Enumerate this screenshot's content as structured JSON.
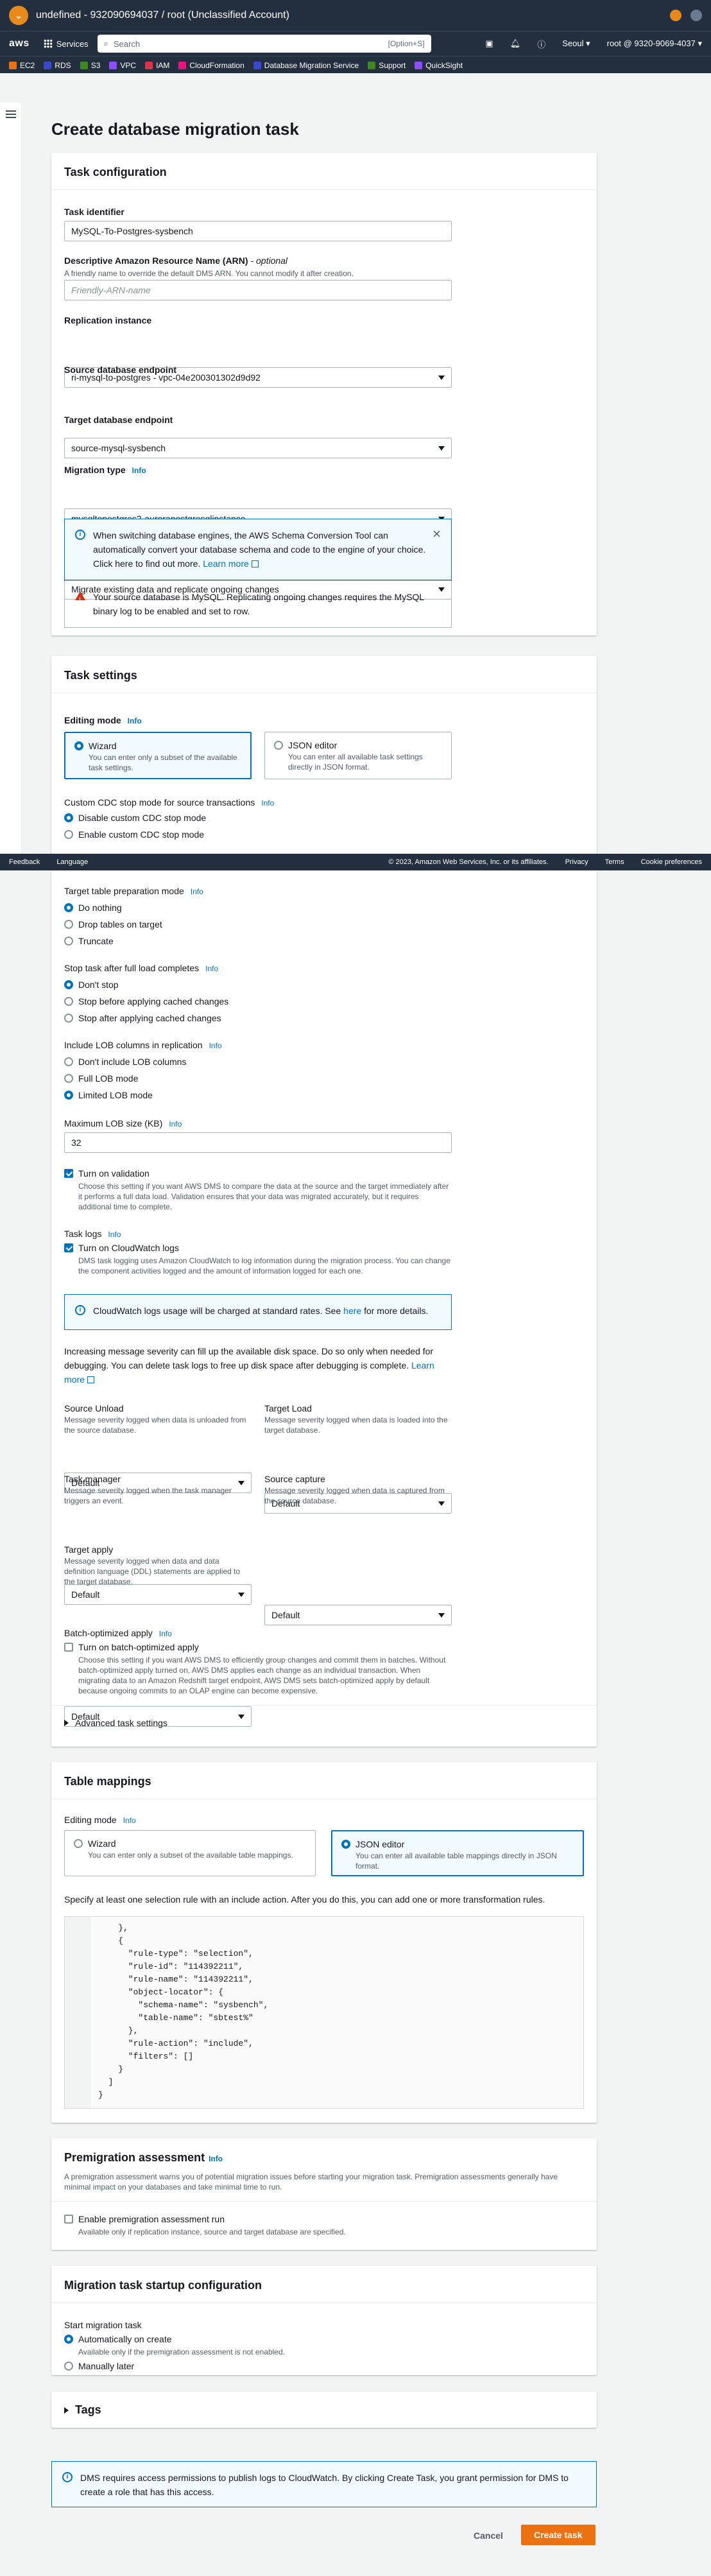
{
  "titlebar": {
    "title": "undefined - 932090694037 / root (Unclassified Account)"
  },
  "nav": {
    "logo": "aws",
    "services": "Services",
    "search_placeholder": "Search",
    "search_kbd": "[Option+S]",
    "region": "Seoul ▾",
    "account": "root @ 9320-9069-4037 ▾",
    "favorites": [
      {
        "label": "EC2",
        "color": "#ec7211"
      },
      {
        "label": "RDS",
        "color": "#3b48cc"
      },
      {
        "label": "S3",
        "color": "#3f8624"
      },
      {
        "label": "VPC",
        "color": "#8c4fff"
      },
      {
        "label": "IAM",
        "color": "#dd344c"
      },
      {
        "label": "CloudFormation",
        "color": "#e7157b"
      },
      {
        "label": "Database Migration Service",
        "color": "#3b48cc"
      },
      {
        "label": "Support",
        "color": "#3f8624"
      },
      {
        "label": "QuickSight",
        "color": "#8c4fff"
      }
    ]
  },
  "page": {
    "title": "Create database migration task"
  },
  "task_config": {
    "header": "Task configuration",
    "identifier_label": "Task identifier",
    "identifier_value": "MySQL-To-Postgres-sysbench",
    "arn_label": "Descriptive Amazon Resource Name (ARN)",
    "arn_optional": "- optional",
    "arn_desc": "A friendly name to override the default DMS ARN. You cannot modify it after creation.",
    "arn_placeholder": "Friendly-ARN-name",
    "replication_label": "Replication instance",
    "replication_value": "ri-mysql-to-postgres - vpc-04e200301302d9d92",
    "source_label": "Source database endpoint",
    "source_value": "source-mysql-sysbench",
    "target_label": "Target database endpoint",
    "target_value": "mysqltopostgres2-aurorapostgresqlinstance",
    "migration_label": "Migration type",
    "info": "Info",
    "migration_value": "Migrate existing data and replicate ongoing changes",
    "sct_alert": "When switching database engines, the AWS Schema Conversion Tool can automatically convert your database schema and code to the engine of your choice. Click here to find out more.",
    "learn_more": "Learn more",
    "warn_alert": "Your source database is MySQL. Replicating ongoing changes requires the MySQL binary log to be enabled and set to row."
  },
  "task_settings": {
    "header": "Task settings",
    "editing_mode": "Editing mode",
    "info": "Info",
    "wizard": "Wizard",
    "wizard_desc": "You can enter only a subset of the available task settings.",
    "json": "JSON editor",
    "json_desc": "You can enter all available task settings directly in JSON format.",
    "cdc_label": "Custom CDC stop mode for source transactions",
    "cdc_options": [
      "Disable custom CDC stop mode",
      "Enable custom CDC stop mode"
    ],
    "prep_label": "Target table preparation mode",
    "prep_options": [
      "Do nothing",
      "Drop tables on target",
      "Truncate"
    ],
    "stop_label": "Stop task after full load completes",
    "stop_options": [
      "Don't stop",
      "Stop before applying cached changes",
      "Stop after applying cached changes"
    ],
    "lob_label": "Include LOB columns in replication",
    "lob_options": [
      "Don't include LOB columns",
      "Full LOB mode",
      "Limited LOB mode"
    ],
    "lob_size_label": "Maximum LOB size (KB)",
    "lob_size_value": "32",
    "validation_label": "Turn on validation",
    "validation_desc": "Choose this setting if you want AWS DMS to compare the data at the source and the target immediately after it performs a full data load. Validation ensures that your data was migrated accurately, but it requires additional time to complete.",
    "logs_label": "Task logs",
    "cw_label": "Turn on CloudWatch logs",
    "cw_desc": "DMS task logging uses Amazon CloudWatch to log information during the migration process. You can change the component activities logged and the amount of information logged for each one.",
    "cw_alert_pre": "CloudWatch logs usage will be charged at standard rates. See",
    "cw_alert_link": "here",
    "cw_alert_post": "for more details.",
    "severity_text": "Increasing message severity can fill up the available disk space. Do so only when needed for debugging. You can delete task logs to free up disk space after debugging is complete.",
    "learn_more": "Learn more",
    "source_unload": "Source Unload",
    "source_unload_desc": "Message severity logged when data is unloaded from the source database.",
    "target_load": "Target Load",
    "target_load_desc": "Message severity logged when data is loaded into the target database.",
    "task_manager": "Task manager",
    "task_manager_desc": "Message severity logged when the task manager triggers an event.",
    "source_capture": "Source capture",
    "source_capture_desc": "Message severity logged when data is captured from the source database.",
    "target_apply": "Target apply",
    "target_apply_desc": "Message severity logged when data and data definition language (DDL) statements are applied to the target database.",
    "default": "Default",
    "batch_label": "Batch-optimized apply",
    "batch_cb": "Turn on batch-optimized apply",
    "batch_desc": "Choose this setting if you want AWS DMS to efficiently group changes and commit them in batches. Without batch-optimized apply turned on, AWS DMS applies each change as an individual transaction. When migrating data to an Amazon Redshift target endpoint, AWS DMS sets batch-optimized apply by default because ongoing commits to an OLAP engine can become expensive.",
    "advanced": "Advanced task settings"
  },
  "footer": {
    "feedback": "Feedback",
    "language": "Language",
    "copyright": "© 2023, Amazon Web Services, Inc. or its affiliates.",
    "privacy": "Privacy",
    "terms": "Terms",
    "cookies": "Cookie preferences"
  },
  "table_mappings": {
    "header": "Table mappings",
    "editing_mode": "Editing mode",
    "info": "Info",
    "wizard": "Wizard",
    "wizard_desc": "You can enter only a subset of the available table mappings.",
    "json": "JSON editor",
    "json_desc": "You can enter all available table mappings directly in JSON format.",
    "hint": "Specify at least one selection rule with an include action. After you do this, you can add one or more transformation rules.",
    "code": "    },\n    {\n      \"rule-type\": \"selection\",\n      \"rule-id\": \"114392211\",\n      \"rule-name\": \"114392211\",\n      \"object-locator\": {\n        \"schema-name\": \"sysbench\",\n        \"table-name\": \"sbtest%\"\n      },\n      \"rule-action\": \"include\",\n      \"filters\": []\n    }\n  ]\n}"
  },
  "premigration": {
    "header": "Premigration assessment",
    "info": "Info",
    "desc": "A premigration assessment warns you of potential migration issues before starting your migration task. Premigration assessments generally have minimal impact on your databases and take minimal time to run.",
    "cb": "Enable premigration assessment run",
    "cb_desc": "Available only if replication instance, source and target database are specified."
  },
  "startup": {
    "header": "Migration task startup configuration",
    "label": "Start migration task",
    "auto": "Automatically on create",
    "auto_desc": "Available only if the premigration assessment is not enabled.",
    "manual": "Manually later"
  },
  "tags": {
    "label": "Tags"
  },
  "bottom_alert": "DMS requires access permissions to publish logs to CloudWatch. By clicking Create Task, you grant permission for DMS to create a role that has this access.",
  "actions": {
    "cancel": "Cancel",
    "create": "Create task"
  }
}
